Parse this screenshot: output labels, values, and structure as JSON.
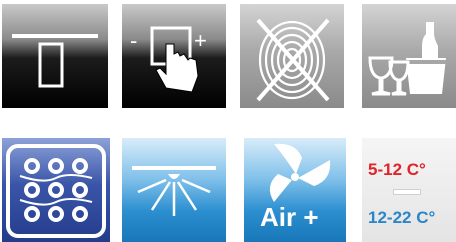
{
  "tiles": [
    {
      "name": "tile-door",
      "icon": "door-icon"
    },
    {
      "name": "tile-touch-control",
      "icon": "touch-control-icon",
      "minus": "-",
      "plus": "+"
    },
    {
      "name": "tile-no-fingerprint",
      "icon": "no-fingerprint-icon"
    },
    {
      "name": "tile-wine-glasses",
      "icon": "wine-glasses-bucket-icon"
    },
    {
      "name": "tile-wine-rack",
      "icon": "bottle-rack-icon"
    },
    {
      "name": "tile-interior-light",
      "icon": "ceiling-light-icon"
    },
    {
      "name": "tile-air-plus",
      "icon": "fan-icon",
      "label": "Air +"
    },
    {
      "name": "tile-dual-zone",
      "icon": "dual-zone-icon",
      "upper": "5-12 C°",
      "lower": "12-22 C°"
    }
  ],
  "colors": {
    "upper_temp": "#e0242a",
    "lower_temp": "#2a86c8",
    "navy": "#243c8c",
    "blue": "#2c8fd0"
  }
}
